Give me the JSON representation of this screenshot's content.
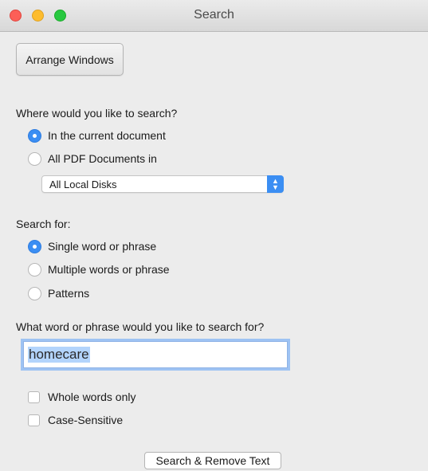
{
  "window": {
    "title": "Search"
  },
  "toolbar": {
    "arrange_label": "Arrange Windows"
  },
  "where": {
    "heading": "Where would you like to search?",
    "options": [
      {
        "label": "In the current document",
        "selected": true
      },
      {
        "label": "All PDF Documents in",
        "selected": false
      }
    ],
    "location_select": {
      "value": "All Local Disks"
    }
  },
  "search_for": {
    "heading": "Search for:",
    "options": [
      {
        "label": "Single word or phrase",
        "selected": true
      },
      {
        "label": "Multiple words or phrase",
        "selected": false
      },
      {
        "label": "Patterns",
        "selected": false
      }
    ]
  },
  "query": {
    "heading": "What word or phrase would you like to search for?",
    "value": "homecare"
  },
  "checkboxes": [
    {
      "label": "Whole words only",
      "checked": false
    },
    {
      "label": "Case-Sensitive",
      "checked": false
    }
  ],
  "actions": {
    "search_remove_label": "Search & Remove Text"
  },
  "colors": {
    "accent": "#3b8ef3",
    "close": "#fc5f57",
    "minimize": "#fdbc2e",
    "maximize": "#28c840",
    "window_bg": "#ececec"
  }
}
